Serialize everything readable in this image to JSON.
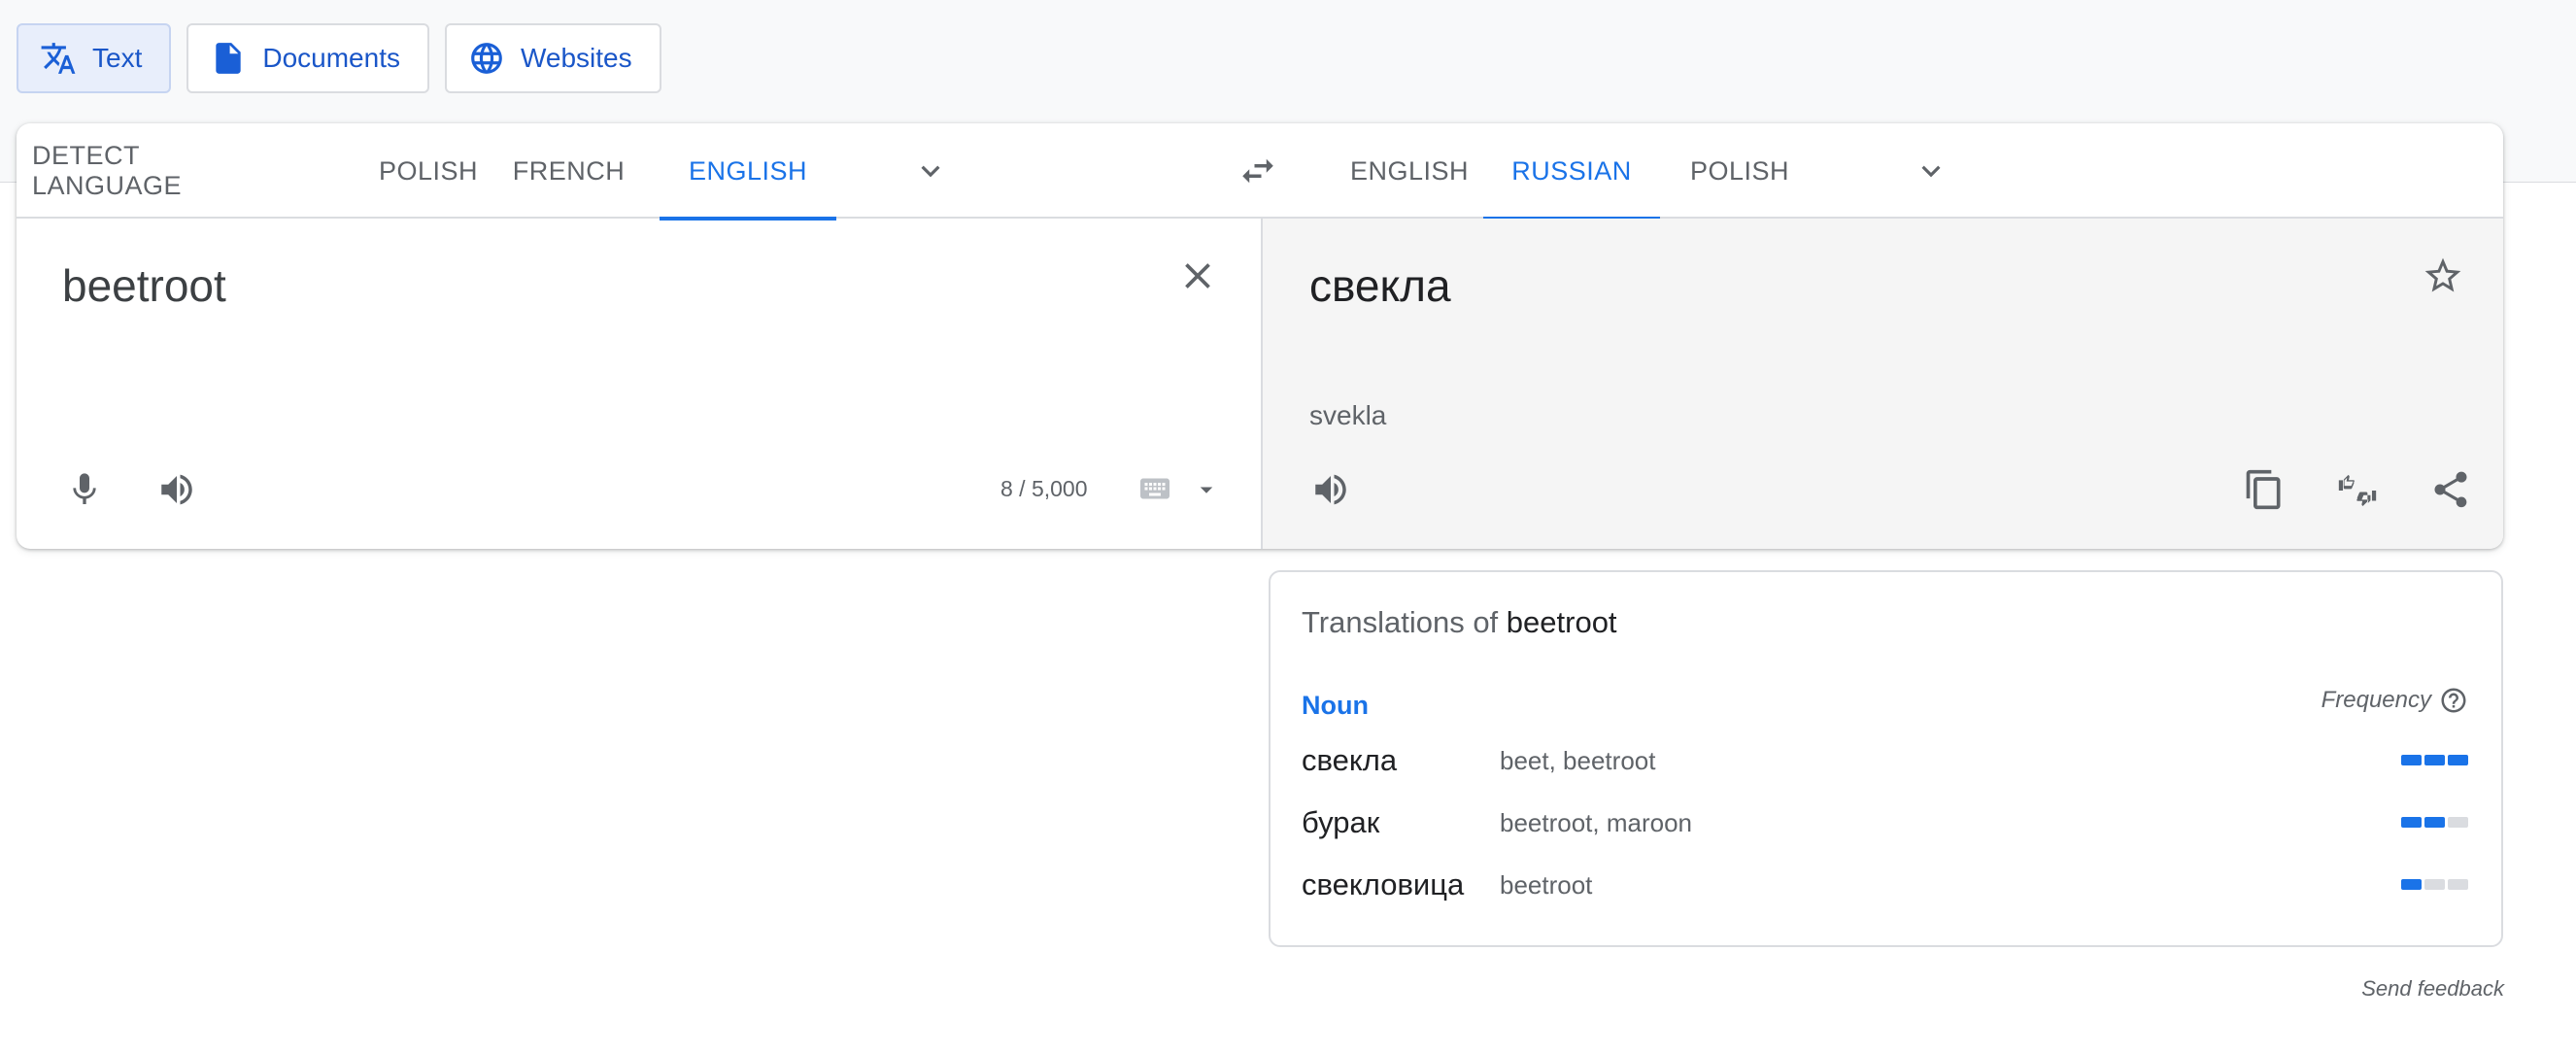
{
  "modes": [
    {
      "label": "Text",
      "icon": "translate-icon",
      "active": true
    },
    {
      "label": "Documents",
      "icon": "document-icon",
      "active": false
    },
    {
      "label": "Websites",
      "icon": "globe-icon",
      "active": false
    }
  ],
  "source_langs": [
    "DETECT LANGUAGE",
    "POLISH",
    "FRENCH",
    "ENGLISH"
  ],
  "source_active": "ENGLISH",
  "target_langs": [
    "ENGLISH",
    "RUSSIAN",
    "POLISH"
  ],
  "target_active": "RUSSIAN",
  "source": {
    "text": "beetroot",
    "counter": "8 / 5,000"
  },
  "target": {
    "text": "свекла",
    "transliteration": "svekla"
  },
  "dictionary": {
    "title_prefix": "Translations of",
    "title_word": "beetroot",
    "part_of_speech": "Noun",
    "frequency_label": "Frequency",
    "entries": [
      {
        "word": "свекла",
        "translations": "beet, beetroot",
        "frequency": 3
      },
      {
        "word": "бурак",
        "translations": "beetroot, maroon",
        "frequency": 2
      },
      {
        "word": "свекловица",
        "translations": "beetroot",
        "frequency": 1
      }
    ]
  },
  "feedback_label": "Send feedback",
  "colors": {
    "accent": "#1a73e8",
    "target_bg": "#f5f5f5",
    "inactive_bar": "#dadce0"
  }
}
